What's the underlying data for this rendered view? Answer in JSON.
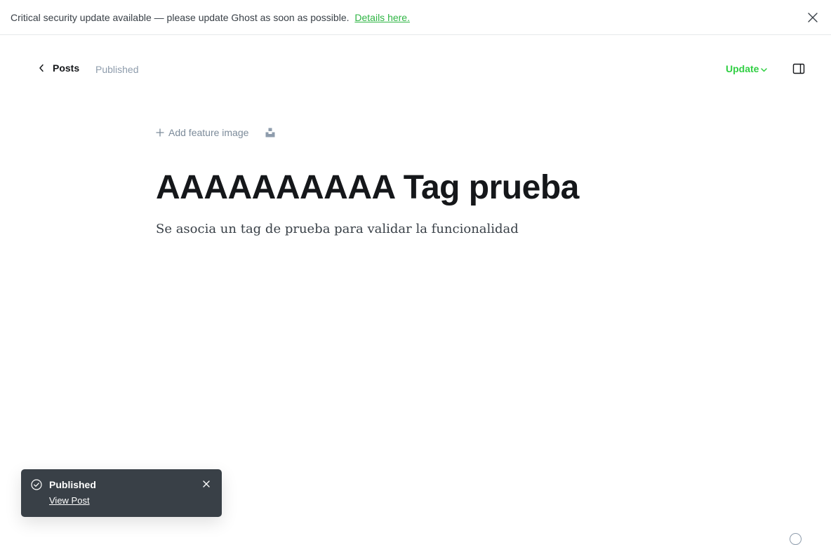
{
  "alert": {
    "message": "Critical security update available — please update Ghost as soon as possible.",
    "link_label": "Details here.",
    "close_icon": "close-icon"
  },
  "header": {
    "back_label": "Posts",
    "back_icon": "chevron-left-icon",
    "status": "Published",
    "update_label": "Update",
    "update_icon": "chevron-down-icon",
    "sidebar_icon": "sidebar-toggle-icon"
  },
  "editor": {
    "feature_image_label": "Add feature image",
    "feature_image_icon": "plus-icon",
    "unsplash_icon": "unsplash-icon",
    "title": "AAAAAAAAAA Tag prueba",
    "excerpt": "Se asocia un tag de prueba para validar la funcionalidad"
  },
  "toast": {
    "title": "Published",
    "link_label": "View Post",
    "icon": "check-circle-icon",
    "close_icon": "close-icon"
  },
  "colors": {
    "accent_green": "#30cf43",
    "toast_bg": "#394047",
    "muted_text": "#8e9cac"
  }
}
